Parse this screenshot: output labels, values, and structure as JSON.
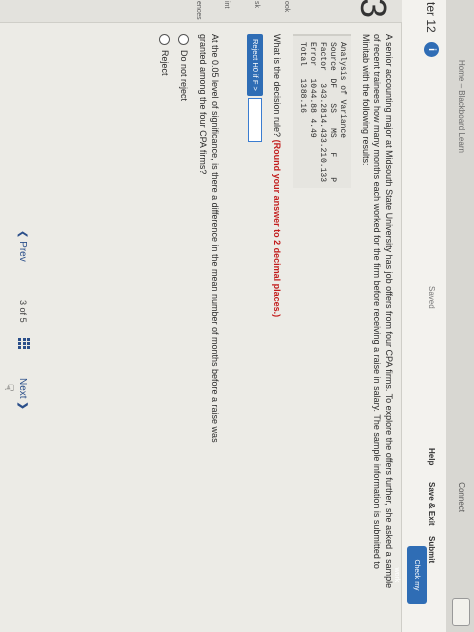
{
  "browser": {
    "tab_title": "Home – Blackboard Learn",
    "connect": "Connect"
  },
  "header": {
    "chapter": "ter 12",
    "info_glyph": "i",
    "status": "Saved",
    "help": "Help",
    "save_exit": "Save & Exit",
    "submit": "Submit",
    "check_work": "Check my work"
  },
  "rail": {
    "question_number": "3",
    "labels": [
      "ook",
      "sk",
      "int",
      "ences"
    ]
  },
  "question": {
    "prompt": "A senior accounting major at Midsouth State University has job offers from four CPA firms. To explore the offers further, she asked a sample of recent trainees how many months each worked for the firm before receiving a raise in salary. The sample information is submitted to Minitab with the following results:",
    "anova": {
      "title": "Analysis of Variance",
      "header": [
        "Source",
        "DF",
        "SS",
        "MS",
        "F",
        "P"
      ],
      "rows": [
        [
          "Factor",
          "3",
          "43.28",
          "14.43",
          "3.21",
          "0.133"
        ],
        [
          "Error",
          "10",
          "44.88",
          "4.49",
          "",
          ""
        ],
        [
          "Total",
          "13",
          "88.16",
          "",
          "",
          ""
        ]
      ]
    },
    "decision_question": "What is the decision rule?",
    "round_note": "(Round your answer to 2 decimal places.)",
    "reject_label": "Reject H0 if F >",
    "rule_value": "",
    "significance_question": "At the 0.05 level of significance, is there a difference in the mean number of months before a raise was granted among the four CPA firms?",
    "options": [
      "Do not reject",
      "Reject"
    ]
  },
  "pager": {
    "prev": "Prev",
    "current": "3",
    "of": "of",
    "total": "5",
    "next": "Next"
  },
  "colors": {
    "accent": "#2f6db5",
    "warning_text": "#c21c1c"
  }
}
